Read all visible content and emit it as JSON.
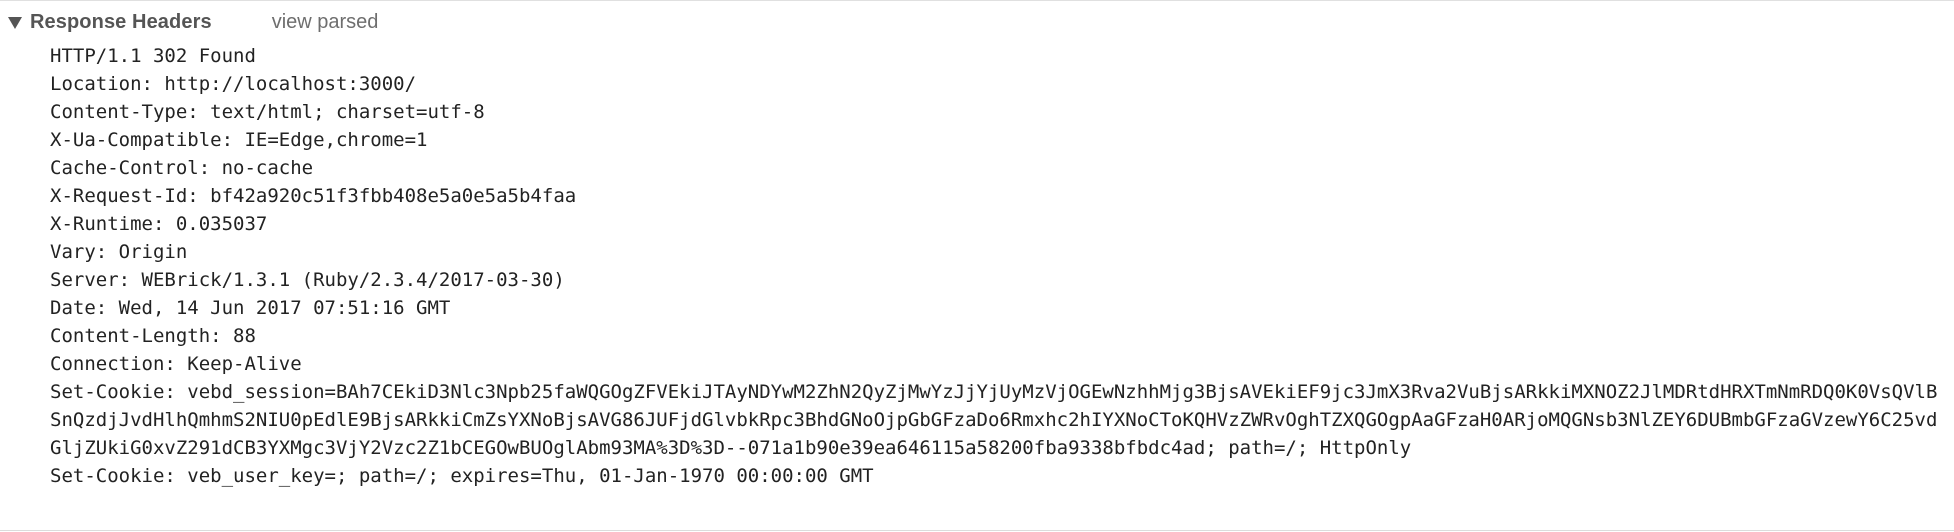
{
  "section": {
    "title": "Response Headers",
    "toggle_label": "view parsed"
  },
  "headers": [
    "HTTP/1.1 302 Found",
    "Location: http://localhost:3000/",
    "Content-Type: text/html; charset=utf-8",
    "X-Ua-Compatible: IE=Edge,chrome=1",
    "Cache-Control: no-cache",
    "X-Request-Id: bf42a920c51f3fbb408e5a0e5a5b4faa",
    "X-Runtime: 0.035037",
    "Vary: Origin",
    "Server: WEBrick/1.3.1 (Ruby/2.3.4/2017-03-30)",
    "Date: Wed, 14 Jun 2017 07:51:16 GMT",
    "Content-Length: 88",
    "Connection: Keep-Alive",
    "Set-Cookie: vebd_session=BAh7CEkiD3Nlc3Npb25faWQGOgZFVEkiJTAyNDYwM2ZhN2QyZjMwYzJjYjUyMzVjOGEwNzhhMjg3BjsAVEkiEF9jc3JmX3Rva2VuBjsARkkiMXNOZ2JlMDRtdHRXTmNmRDQ0K0VsQVlBSnQzdjJvdHlhQmhmS2NIU0pEdlE9BjsARkkiCmZsYXNoBjsAVG86JUFjdGlvbkRpc3BhdGNoOjpGbGFzaDo6Rmxhc2hIYXNoCToKQHVzZWRvOghTZXQGOgpAaGFzaH0ARjoMQGNsb3NlZEY6DUBmbGFzaGVzewY6C25vdGljZUkiG0xvZ291dCB3YXMgc3VjY2Vzc2Z1bCEGOwBUOglAbm93MA%3D%3D--071a1b90e39ea646115a58200fba9338bfbdc4ad; path=/; HttpOnly",
    "Set-Cookie: veb_user_key=; path=/; expires=Thu, 01-Jan-1970 00:00:00 GMT"
  ]
}
